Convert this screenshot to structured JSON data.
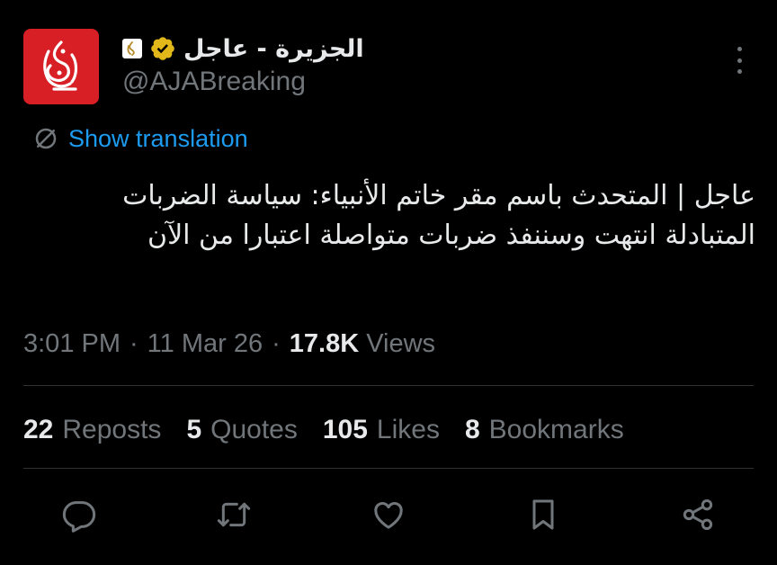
{
  "author": {
    "display_name": "الجزيرة - عاجل",
    "handle": "@AJABreaking",
    "verified": true,
    "avatar_color": "#d81f26",
    "avatar_icon": "al-jazeera-logo"
  },
  "translate": {
    "label": "Show translation",
    "icon": "globe-translate-icon",
    "color": "#1d9bf0"
  },
  "tweet": {
    "text": "عاجل | المتحدث باسم مقر خاتم الأنبياء: سياسة الضربات المتبادلة انتهت وسننفذ ضربات متواصلة اعتبارا من الآن"
  },
  "meta": {
    "time": "3:01 PM",
    "separator": "·",
    "date": "11 Mar 26",
    "views_count": "17.8K",
    "views_label": "Views"
  },
  "stats": [
    {
      "num": "22",
      "label": "Reposts"
    },
    {
      "num": "5",
      "label": "Quotes"
    },
    {
      "num": "105",
      "label": "Likes"
    },
    {
      "num": "8",
      "label": "Bookmarks"
    }
  ],
  "actions": [
    "reply-icon",
    "repost-icon",
    "like-icon",
    "bookmark-icon",
    "share-icon"
  ],
  "colors": {
    "background": "#000000",
    "text": "#e7e9ea",
    "secondary": "#71767b",
    "divider": "#2f3336",
    "verified": "#e2b719"
  }
}
